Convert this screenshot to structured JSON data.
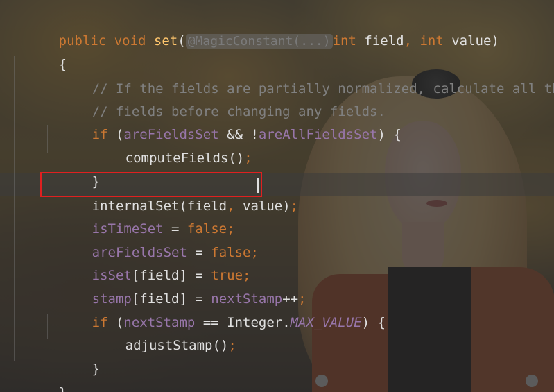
{
  "editor": {
    "signature": {
      "modifiers": "public void ",
      "method_name": "set",
      "open_paren": "(",
      "annotation_hint": "@MagicConstant(...)",
      "param1_type": "int",
      "param1_name": " field",
      "comma": ",",
      "param2_type": " int",
      "param2_name": " value",
      "close_paren": ")"
    },
    "open_brace": "{",
    "comment_line1": "// If the fields are partially normalized, calculate all the",
    "comment_line2": "// fields before changing any fields.",
    "if1": {
      "kw": "if",
      "open": " (",
      "var1": "areFieldsSet",
      "op": " && !",
      "var2": "areAllFieldsSet",
      "close": ") {"
    },
    "compute_call": "computeFields()",
    "compute_semi": ";",
    "close_brace_inner": "}",
    "internal_set": {
      "call": "internalSet(field",
      "comma": ",",
      "rest": " value)",
      "semi": ";"
    },
    "assign_time": {
      "field": "isTimeSet",
      "eq": " = ",
      "value": "false",
      "semi": ";"
    },
    "assign_fields": {
      "field": "areFieldsSet",
      "eq": " = ",
      "value": "false",
      "semi": ";"
    },
    "assign_isset": {
      "field": "isSet",
      "index": "[field]",
      "eq": " = ",
      "value": "true",
      "semi": ";"
    },
    "assign_stamp": {
      "field": "stamp",
      "index": "[field]",
      "eq": " = ",
      "value": "nextStamp",
      "inc": "++",
      "semi": ";"
    },
    "if2": {
      "kw": "if",
      "open": " (",
      "var": "nextStamp",
      "op": " == Integer.",
      "const": "MAX_VALUE",
      "close": ") {"
    },
    "adjust_call": "adjustStamp()",
    "adjust_semi": ";",
    "close_brace_inner2": "}",
    "close_brace_outer": "}"
  },
  "colors": {
    "keyword": "#cc7832",
    "method": "#ffc66d",
    "field": "#9876aa",
    "comment": "#808080",
    "highlight_box": "#e02020"
  },
  "background_image": "autumn-portrait-wallpaper"
}
